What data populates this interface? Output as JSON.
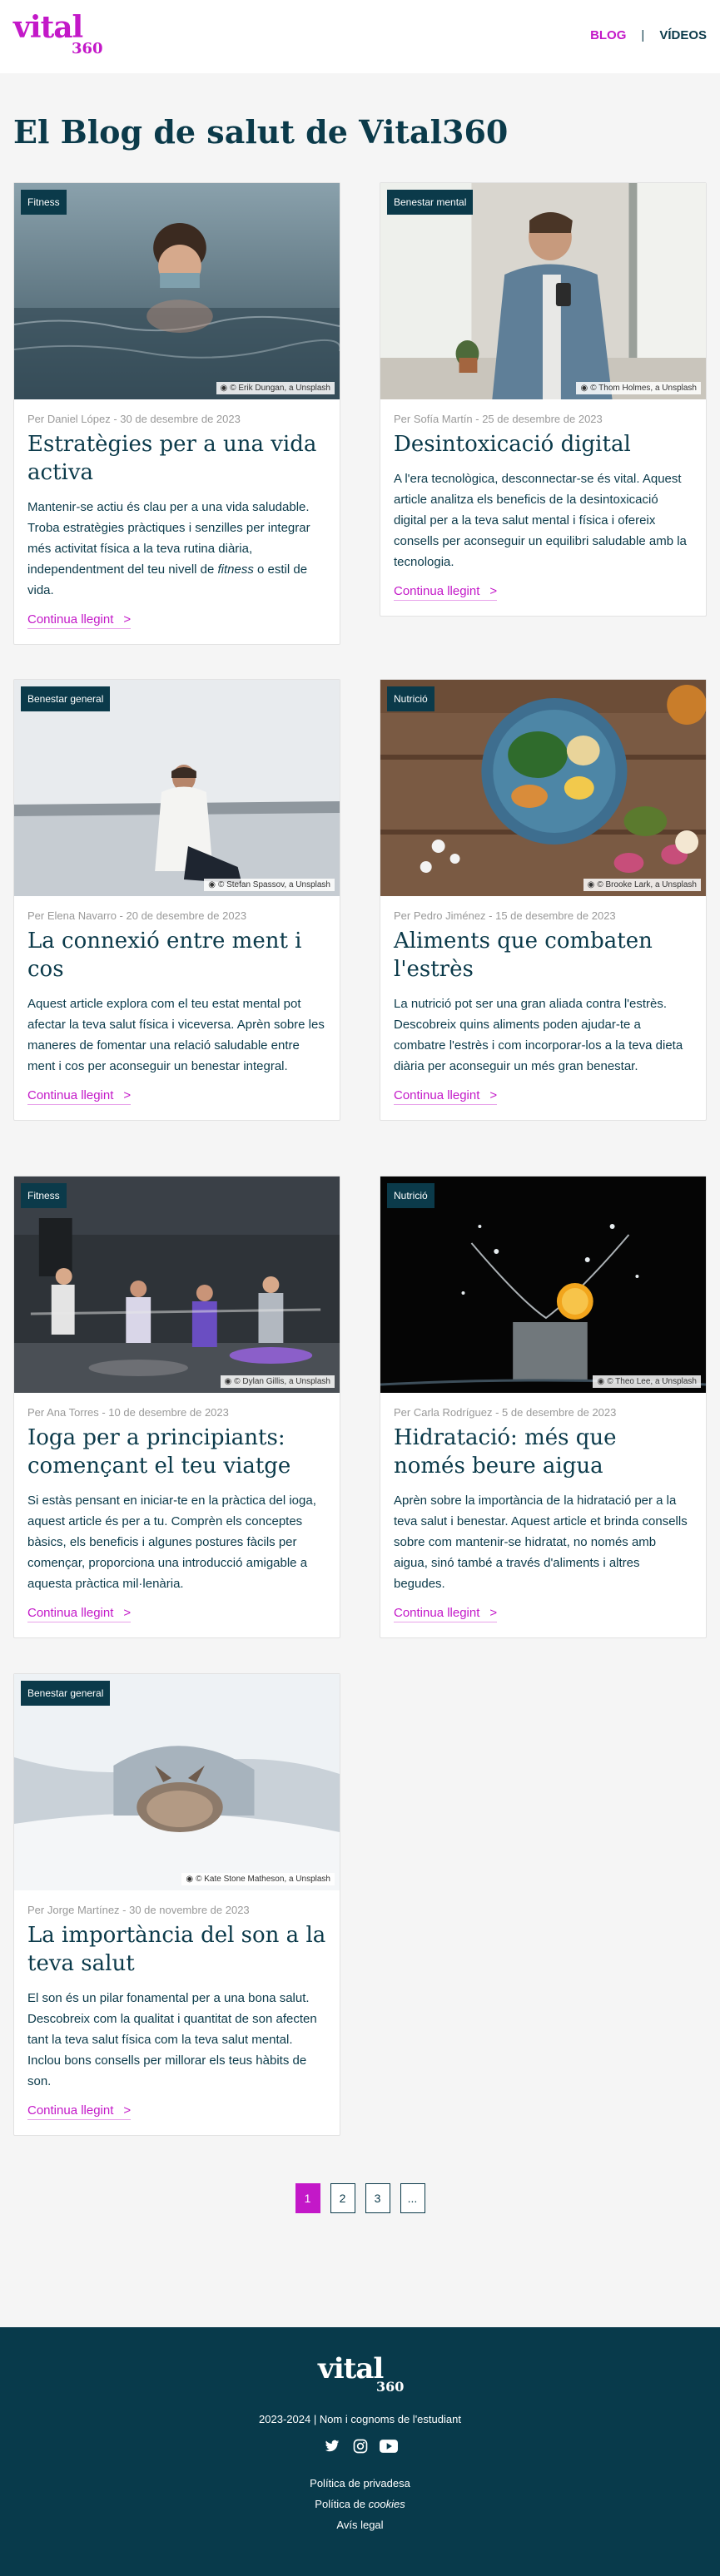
{
  "header": {
    "logo_text": "vital",
    "logo_num": "360",
    "nav": [
      {
        "label": "BLOG"
      },
      {
        "label": "|"
      },
      {
        "label": "VÍDEOS"
      }
    ]
  },
  "page_title": "El Blog de salut de Vital360",
  "posts": [
    {
      "tag": "Fitness",
      "credit": "© Erik Dungan, a Unsplash",
      "meta": "Per Daniel López - 30 de desembre de 2023",
      "title": "Estratègies per a una vida activa",
      "excerpt_a": "Mantenir-se actiu és clau per a una vida saludable. Troba estratègies pràctiques i senzilles per integrar més activitat física a la teva rutina diària, independentment del teu nivell de ",
      "excerpt_em": "fitness",
      "excerpt_b": " o estil de vida.",
      "read_more": "Continua llegint"
    },
    {
      "tag": "Benestar mental",
      "credit": "© Thom Holmes, a Unsplash",
      "meta": "Per Sofía Martín - 25 de desembre de 2023",
      "title": "Desintoxicació digital",
      "excerpt": "A l'era tecnològica, desconnectar-se és vital. Aquest article analitza els beneficis de la desintoxicació digital per a la teva salut mental i física i ofereix consells per aconseguir un equilibri saludable amb la tecnologia.",
      "read_more": "Continua llegint"
    },
    {
      "tag": "Benestar general",
      "credit": "© Stefan Spassov, a Unsplash",
      "meta": "Per Elena Navarro - 20 de desembre de 2023",
      "title": "La connexió entre ment i cos",
      "excerpt": "Aquest article explora com el teu estat mental pot afectar la teva salut física i viceversa. Aprèn sobre les maneres de fomentar una relació saludable entre ment i cos per aconseguir un benestar integral.",
      "read_more": "Continua llegint"
    },
    {
      "tag": "Nutrició",
      "credit": "© Brooke Lark, a Unsplash",
      "meta": "Per Pedro Jiménez - 15 de desembre de 2023",
      "title": "Aliments que combaten l'estrès",
      "excerpt": "La nutrició pot ser una gran aliada contra l'estrès. Descobreix quins aliments poden ajudar-te a combatre l'estrès i com incorporar-los a la teva dieta diària per aconseguir un més gran benestar.",
      "read_more": "Continua llegint"
    },
    {
      "tag": "Fitness",
      "credit": "© Dylan Gillis, a Unsplash",
      "meta": "Per Ana Torres - 10 de desembre de 2023",
      "title": "Ioga per a principiants: començant el teu viatge",
      "excerpt": "Si estàs pensant en iniciar-te en la pràctica del ioga, aquest article és per a tu. Comprèn els conceptes bàsics, els beneficis i algunes postures fàcils per començar, proporciona una introducció amigable a aquesta pràctica mil·lenària.",
      "read_more": "Continua llegint"
    },
    {
      "tag": "Nutrició",
      "credit": "© Theo Lee, a Unsplash",
      "meta": "Per Carla Rodríguez - 5 de desembre de 2023",
      "title": "Hidratació: més que només beure aigua",
      "excerpt": "Aprèn sobre la importància de la hidratació per a la teva salut i benestar. Aquest article et brinda consells sobre com mantenir-se hidratat, no només amb aigua, sinó també a través d'aliments i altres begudes.",
      "read_more": "Continua llegint"
    },
    {
      "tag": "Benestar general",
      "credit": "© Kate Stone Matheson, a Unsplash",
      "meta": "Per Jorge Martínez - 30 de novembre de 2023",
      "title": "La importància del son a la teva salut",
      "excerpt": "El son és un pilar fonamental per a una bona salut. Descobreix com la qualitat i quantitat de son afecten tant la teva salut física com la teva salut mental. Inclou bons consells per millorar els teus hàbits de son.",
      "read_more": "Continua llegint"
    }
  ],
  "pagination": [
    "1",
    "2",
    "3",
    "..."
  ],
  "footer": {
    "logo_text": "vital",
    "logo_num": "360",
    "copyright": "2023-2024 | Nom i cognoms de l'estudiant",
    "links": [
      {
        "label": "Política de privadesa"
      },
      {
        "label_a": "Política de ",
        "label_em": "cookies"
      },
      {
        "label": "Avís legal"
      }
    ]
  },
  "colors": {
    "accent": "#c318c8",
    "primary": "#0b3a4a",
    "footer_bg": "#083a4b"
  },
  "icons": [
    "twitter-icon",
    "instagram-icon",
    "youtube-icon",
    "camera-icon",
    "chevron-right-icon"
  ]
}
